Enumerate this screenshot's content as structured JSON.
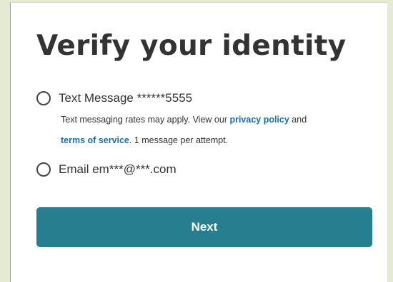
{
  "page": {
    "title": "Verify your identity",
    "options": [
      {
        "label": "Text Message ******5555"
      },
      {
        "label": "Email em***@***.com"
      }
    ],
    "sms_note": {
      "text1": "Text messaging rates may apply. View our ",
      "privacy_link": "privacy policy",
      "text2": " and",
      "terms_link": "terms of service",
      "text3": ". 1 message per attempt."
    },
    "next_label": "Next"
  },
  "colors": {
    "background": "#e3ebd2",
    "accent": "#267e8f",
    "link": "#1a6fa8"
  }
}
